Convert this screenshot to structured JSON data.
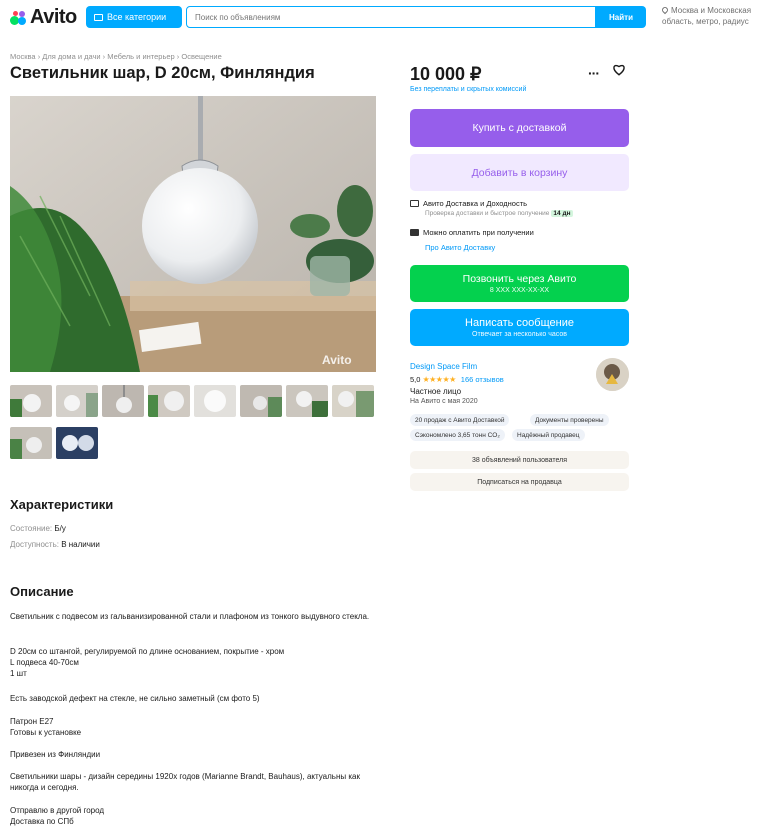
{
  "header": {
    "logo": "Avito",
    "all_categories": "Все категории",
    "search_placeholder": "Поиск по объявлениям",
    "search_button": "Найти",
    "location_line1": "Москва и Московская",
    "location_line2": "область, метро, радиус"
  },
  "breadcrumb": "Москва › Для дома и дачи › Мебель и интерьер › Освещение",
  "title": "Светильник шар, D 20см, Финляндия",
  "price": {
    "value": "10 000 ₽",
    "note": "Без переплаты и скрытых комиссий"
  },
  "actions": {
    "buy": "Купить с доставкой",
    "cart": "Добавить в корзину",
    "call": "Позвонить через Авито",
    "call_sub": "8 XXX XXX-XX-XX",
    "message": "Написать сообщение",
    "message_sub": "Отвечает за несколько часов"
  },
  "delivery": {
    "line1": "Авито Доставка и Доходность",
    "line1_sub": "Проверка доставки и быстрое получение",
    "line1_tag": "14 дн",
    "line2": "Можно оплатить при получении",
    "link": "Про Авито Доставку"
  },
  "seller": {
    "name": "Design Space Film",
    "rating": "5,0",
    "stars": "★★★★★",
    "reviews": "166 отзывов",
    "type": "Частное лицо",
    "since": "На Авито с мая 2020",
    "chips": [
      "20 продаж с Авито Доставкой",
      "Документы проверены",
      "Сэкономлено 3,65 тонн CO₂",
      "Надёжный продавец"
    ],
    "ads_button": "38 объявлений пользователя",
    "subscribe_button": "Подписаться на продавца"
  },
  "characteristics": {
    "heading": "Характеристики",
    "rows": [
      {
        "k": "Состояние: ",
        "v": "Б/у"
      },
      {
        "k": "Доступность: ",
        "v": "В наличии"
      }
    ]
  },
  "description": {
    "heading": "Описание",
    "paragraphs": [
      "Светильник с подвесом из гальванизированной стали и плафоном из тонкого выдувного стекла.",
      "D 20см со штангой, регулируемой по длине основанием, покрытие - хром\nL подвеса 40-70см\n1 шт",
      "Есть заводской дефект на стекле, не сильно заметный (см фото 5)",
      "Патрон E27\nГотовы к установке",
      "Привезен из Финляндии",
      "Светильники шары - дизайн середины 1920х годов (Marianne Brandt, Bauhaus), актуальны как никогда и сегодня.",
      "Отправлю в другой город\nДоставка по СПб"
    ]
  },
  "colors": {
    "blue": "#00aaff",
    "purple": "#965eeb",
    "green": "#04d14e",
    "link": "#0099f7"
  }
}
